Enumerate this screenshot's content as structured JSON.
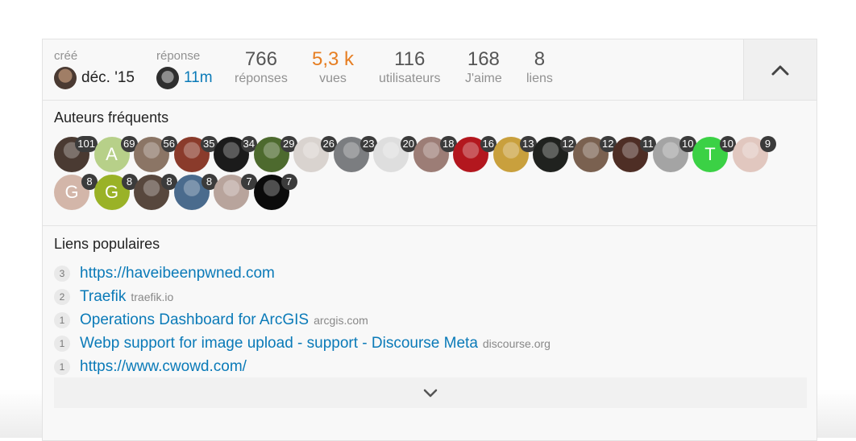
{
  "stats": {
    "created_label": "créé",
    "created_value": "déc. '15",
    "replied_label": "réponse",
    "replied_value": "11m",
    "items": [
      {
        "num": "766",
        "label": "réponses"
      },
      {
        "num": "5,3 k",
        "label": "vues"
      },
      {
        "num": "116",
        "label": "utilisateurs"
      },
      {
        "num": "168",
        "label": "J'aime"
      },
      {
        "num": "8",
        "label": "liens"
      }
    ]
  },
  "posters": {
    "title": "Auteurs fréquents",
    "avatars": [
      {
        "count": "101",
        "color": "#4a3a32",
        "letter": ""
      },
      {
        "count": "69",
        "color": "#b7d089",
        "letter": "A"
      },
      {
        "count": "56",
        "color": "#8b7565",
        "letter": ""
      },
      {
        "count": "35",
        "color": "#8a3b2b",
        "letter": ""
      },
      {
        "count": "34",
        "color": "#1b1b1b",
        "letter": ""
      },
      {
        "count": "29",
        "color": "#4d6a2e",
        "letter": ""
      },
      {
        "count": "26",
        "color": "#d9d3cf",
        "letter": ""
      },
      {
        "count": "23",
        "color": "#7b7d80",
        "letter": ""
      },
      {
        "count": "20",
        "color": "#dedede",
        "letter": ""
      },
      {
        "count": "18",
        "color": "#9c7d76",
        "letter": ""
      },
      {
        "count": "16",
        "color": "#b3171e",
        "letter": ""
      },
      {
        "count": "13",
        "color": "#c9a03d",
        "letter": ""
      },
      {
        "count": "12",
        "color": "#20221f",
        "letter": ""
      },
      {
        "count": "12",
        "color": "#7a6150",
        "letter": ""
      },
      {
        "count": "11",
        "color": "#4e2e25",
        "letter": ""
      },
      {
        "count": "10",
        "color": "#a4a4a4",
        "letter": ""
      },
      {
        "count": "10",
        "color": "#3bd145",
        "letter": "T"
      },
      {
        "count": "9",
        "color": "#e1c7bf",
        "letter": ""
      },
      {
        "count": "8",
        "color": "#d3b6a9",
        "letter": "G"
      },
      {
        "count": "8",
        "color": "#9ab227",
        "letter": "G"
      },
      {
        "count": "8",
        "color": "#57473d",
        "letter": ""
      },
      {
        "count": "8",
        "color": "#4a6b8d",
        "letter": ""
      },
      {
        "count": "7",
        "color": "#b8a49c",
        "letter": ""
      },
      {
        "count": "7",
        "color": "#0b0b0b",
        "letter": ""
      }
    ]
  },
  "links": {
    "title": "Liens populaires",
    "items": [
      {
        "count": "3",
        "title": "https://haveibeenpwned.com",
        "domain": ""
      },
      {
        "count": "2",
        "title": "Traefik",
        "domain": "traefik.io"
      },
      {
        "count": "1",
        "title": "Operations Dashboard for ArcGIS",
        "domain": "arcgis.com"
      },
      {
        "count": "1",
        "title": "Webp support for image upload - support - Discourse Meta",
        "domain": "discourse.org"
      },
      {
        "count": "1",
        "title": "https://www.cwowd.com/",
        "domain": ""
      }
    ]
  },
  "icons": {
    "collapse": "chevron-up-icon",
    "expand": "chevron-down-icon"
  },
  "colors": {
    "link": "#0a7ab8",
    "views_hot": "#e67e22",
    "badge": "#3b3b3b"
  }
}
